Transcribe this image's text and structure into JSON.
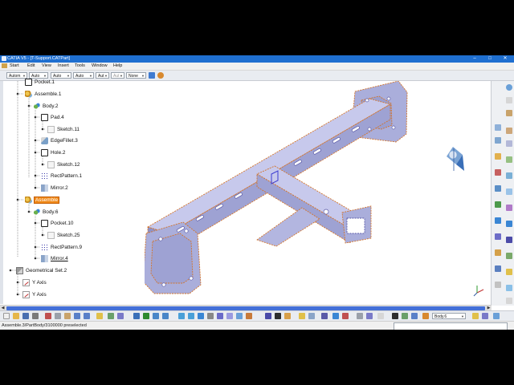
{
  "window": {
    "title": "CATIA V5 - [T-Support.CATPart]",
    "controls": [
      "–",
      "□",
      "✕"
    ]
  },
  "menu": [
    "Start",
    "Edit",
    "View",
    "Insert",
    "Tools",
    "Window",
    "Help"
  ],
  "toolbar": {
    "combos": [
      "Autom",
      "Auto",
      "Auto",
      "Auto",
      "Aut",
      "Aut",
      "None"
    ]
  },
  "tree": {
    "nodes": [
      {
        "label": "Pocket.1",
        "icon": "pocket-icon"
      },
      {
        "label": "Assemble.1",
        "icon": "assemble-icon"
      },
      {
        "label": "Body.2",
        "icon": "body-icon"
      },
      {
        "label": "Pad.4",
        "icon": "pad-icon"
      },
      {
        "label": "Sketch.11",
        "icon": "sketch-icon"
      },
      {
        "label": "EdgeFillet.3",
        "icon": "edgefillet-icon"
      },
      {
        "label": "Hole.2",
        "icon": "hole-icon"
      },
      {
        "label": "Sketch.12",
        "icon": "sketch-icon"
      },
      {
        "label": "RectPattern.1",
        "icon": "rectpattern-icon"
      },
      {
        "label": "Mirror.2",
        "icon": "mirror-icon"
      },
      {
        "label": "Assemble",
        "icon": "assemble-icon",
        "selected": true
      },
      {
        "label": "Body.6",
        "icon": "body-icon"
      },
      {
        "label": "Pocket.10",
        "icon": "pocket-icon"
      },
      {
        "label": "Sketch.25",
        "icon": "sketch-icon"
      },
      {
        "label": "RectPattern.9",
        "icon": "rectpattern-icon"
      },
      {
        "label": "Mirror.4",
        "icon": "mirror-icon",
        "underlined": true
      },
      {
        "label": "Geometrical Set.2",
        "icon": "geometrical-set-icon"
      },
      {
        "label": "Y Axis",
        "icon": "axis-icon"
      },
      {
        "label": "Y Axis",
        "icon": "axis-icon"
      }
    ]
  },
  "bottom_toolbar": {
    "combo": "Body.6"
  },
  "status": {
    "message": "Assemble.3/PartBody/3100000 preselected"
  },
  "colors": {
    "title_bar": "#1f6fd0",
    "selection": "#f08a1a",
    "model_face": "#a9acd8",
    "model_edge": "#d4742a"
  }
}
